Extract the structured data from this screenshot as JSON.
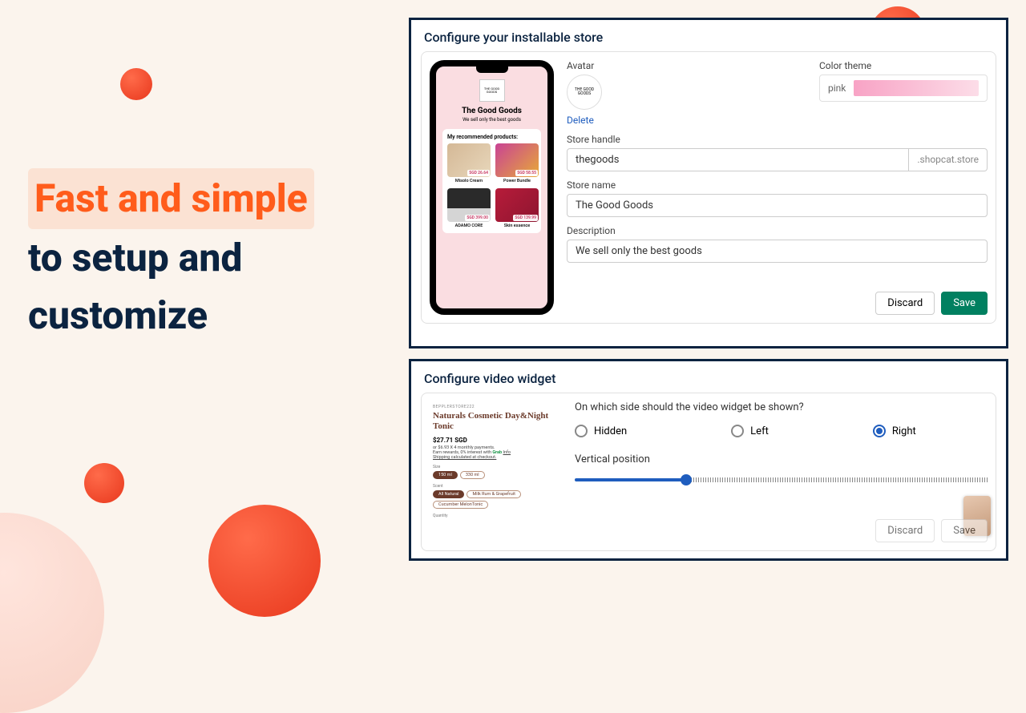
{
  "hero": {
    "line1": "Fast and simple",
    "line2": "to setup and",
    "line3": "customize"
  },
  "store_panel": {
    "title": "Configure your installable store",
    "avatar_label": "Avatar",
    "avatar_text": "THE GOOD GOODS",
    "delete": "Delete",
    "color_label": "Color theme",
    "color_name": "pink",
    "handle_label": "Store handle",
    "handle_value": "thegoods",
    "handle_suffix": ".shopcat.store",
    "storename_label": "Store name",
    "storename_value": "The Good Goods",
    "desc_label": "Description",
    "desc_value": "We sell only the best goods",
    "discard": "Discard",
    "save": "Save"
  },
  "phone": {
    "logo": "THE GOOD GOODS",
    "title": "The Good Goods",
    "sub": "We sell only the best goods",
    "section": "My recommended products:",
    "products": [
      {
        "name": "Misolo Cream",
        "price": "SGD 26.64"
      },
      {
        "name": "Power Bundle",
        "price": "SGD 58.55"
      },
      {
        "name": "ADAMO CORE",
        "price": "SGD 399.00"
      },
      {
        "name": "Skin essence",
        "price": "SGD 139.99"
      }
    ]
  },
  "video_panel": {
    "title": "Configure video widget",
    "preview": {
      "store": "BEPPLERSTORE222",
      "product": "Naturals Cosmetic Day&Night Tonic",
      "price": "$27.71 SGD",
      "installment": "or $6.93 X 4 monthly payments.",
      "rewards": "Earn rewards, 0% interest with",
      "grab": "Grab",
      "info": "Info",
      "shipping": "Shipping calculated at checkout.",
      "size_label": "Size",
      "sizes": [
        "150 ml",
        "330 ml"
      ],
      "scent_label": "Scent",
      "scents": [
        "All Natural",
        "Milk Rum & Grapefruit",
        "Cucumber MelonTonic"
      ],
      "qty_label": "Quantity"
    },
    "question": "On which side should the video widget be shown?",
    "options": {
      "hidden": "Hidden",
      "left": "Left",
      "right": "Right"
    },
    "vpos_label": "Vertical position",
    "discard": "Discard",
    "save": "Save"
  }
}
